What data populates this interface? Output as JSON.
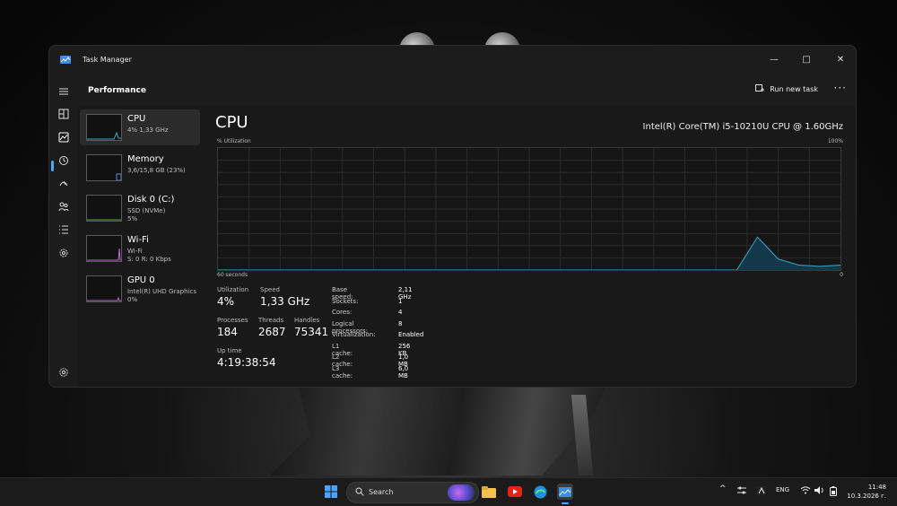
{
  "window": {
    "title": "Task Manager",
    "minimize_glyph": "—",
    "maximize_glyph": "□",
    "close_glyph": "✕"
  },
  "header": {
    "page_title": "Performance",
    "run_task_label": "Run new task",
    "more_label": "···"
  },
  "rail_icons": [
    "hamburger-icon",
    "processes-icon",
    "performance-icon",
    "app-history-icon",
    "startup-icon",
    "users-icon",
    "details-icon",
    "services-icon",
    "settings-icon"
  ],
  "sidebar": {
    "items": [
      {
        "name": "CPU",
        "sub1": "4% 1,33 GHz",
        "sub2": ""
      },
      {
        "name": "Memory",
        "sub1": "3,6/15,8 GB (23%)",
        "sub2": ""
      },
      {
        "name": "Disk 0 (C:)",
        "sub1": "SSD (NVMe)",
        "sub2": "5%"
      },
      {
        "name": "Wi-Fi",
        "sub1": "Wi-Fi",
        "sub2": "S: 0 R: 0 Kbps"
      },
      {
        "name": "GPU 0",
        "sub1": "Intel(R) UHD Graphics",
        "sub2": "0%"
      }
    ]
  },
  "cpu": {
    "title": "CPU",
    "model": "Intel(R) Core(TM) i5-10210U CPU @ 1.60GHz",
    "util_label": "% Utilization",
    "max_label": "100%",
    "time_label": "60 seconds",
    "zero_label": "0"
  },
  "chart_data": {
    "type": "area",
    "x": [
      60,
      58,
      56,
      54,
      52,
      50,
      48,
      46,
      44,
      42,
      40,
      38,
      36,
      34,
      32,
      30,
      28,
      26,
      24,
      22,
      20,
      18,
      16,
      14,
      12,
      10,
      8,
      6,
      4,
      2,
      0
    ],
    "values": [
      0,
      0,
      0,
      0,
      0,
      0,
      0,
      0,
      0,
      0,
      0,
      0,
      0,
      0,
      0,
      0,
      0,
      0,
      0,
      0,
      0,
      0,
      0,
      0,
      0,
      0,
      27,
      9,
      4,
      3,
      4
    ],
    "ylim": [
      0,
      100
    ],
    "xlim": [
      60,
      0
    ],
    "grid": true
  },
  "stats": {
    "utilization": {
      "label": "Utilization",
      "value": "4%"
    },
    "speed": {
      "label": "Speed",
      "value": "1,33 GHz"
    },
    "processes": {
      "label": "Processes",
      "value": "184"
    },
    "threads": {
      "label": "Threads",
      "value": "2687"
    },
    "handles": {
      "label": "Handles",
      "value": "75341"
    },
    "uptime": {
      "label": "Up time",
      "value": "4:19:38:54"
    }
  },
  "info": [
    {
      "k": "Base speed:",
      "v": "2,11 GHz"
    },
    {
      "k": "Sockets:",
      "v": "1"
    },
    {
      "k": "Cores:",
      "v": "4"
    },
    {
      "k": "Logical processors:",
      "v": "8"
    },
    {
      "k": "Virtualization:",
      "v": "Enabled"
    },
    {
      "k": "L1 cache:",
      "v": "256 KB"
    },
    {
      "k": "L2 cache:",
      "v": "1,0 MB"
    },
    {
      "k": "L3 cache:",
      "v": "6,0 MB"
    }
  ],
  "taskbar": {
    "search_label": "Search",
    "language": "ENG",
    "time": "11:48",
    "date": "10.3.2026 г."
  },
  "colors": {
    "accent": "#4da3ff",
    "graph_line": "#3fa7c9",
    "graph_fill": "#12384a"
  }
}
